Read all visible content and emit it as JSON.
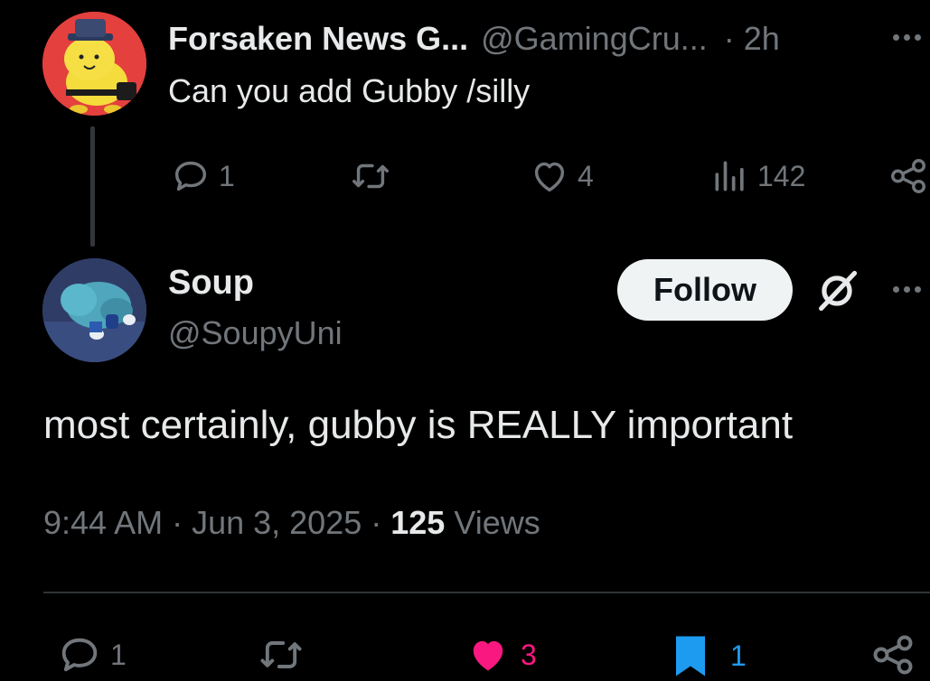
{
  "parent_tweet": {
    "display_name": "Forsaken News G...",
    "handle": "@GamingCru...",
    "separator": "·",
    "time": "2h",
    "text": "Can you add Gubby /silly",
    "actions": {
      "replies": "1",
      "likes": "4",
      "views": "142"
    }
  },
  "reply_tweet": {
    "display_name": "Soup",
    "handle": "@SoupyUni",
    "follow_label": "Follow",
    "text": "most certainly, gubby is REALLY important",
    "time": "9:44 AM",
    "date": "Jun 3, 2025",
    "separator": "·",
    "views_count": "125",
    "views_label": "Views",
    "actions": {
      "replies": "1",
      "likes": "3",
      "bookmarks": "1"
    }
  },
  "colors": {
    "background": "#000000",
    "text_primary": "#e7e9ea",
    "text_secondary": "#71767b",
    "like_active": "#f91880",
    "bookmark_active": "#1d9bf0",
    "follow_bg": "#eff3f4"
  },
  "icons": [
    "reply-icon",
    "retweet-icon",
    "like-icon",
    "views-icon",
    "share-icon",
    "grok-icon",
    "more-icon",
    "bookmark-icon"
  ]
}
